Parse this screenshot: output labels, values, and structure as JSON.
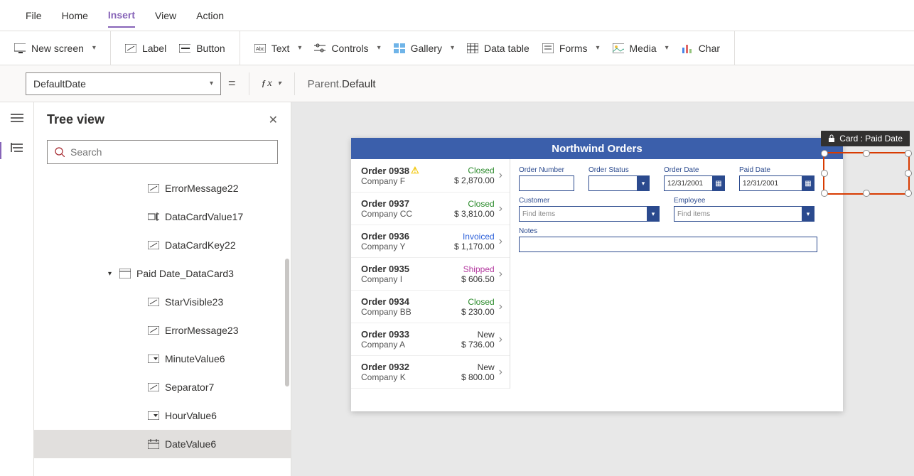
{
  "menu": {
    "items": [
      "File",
      "Home",
      "Insert",
      "View",
      "Action"
    ],
    "active": "Insert"
  },
  "ribbon": {
    "new_screen": "New screen",
    "label": "Label",
    "button": "Button",
    "text": "Text",
    "controls": "Controls",
    "gallery": "Gallery",
    "data_table": "Data table",
    "forms": "Forms",
    "media": "Media",
    "charts": "Char"
  },
  "formula": {
    "property": "DefaultDate",
    "prefix": "Parent.",
    "value": "Default"
  },
  "tree": {
    "title": "Tree view",
    "search_placeholder": "Search",
    "items": [
      {
        "name": "ErrorMessage22",
        "icon": "label"
      },
      {
        "name": "DataCardValue17",
        "icon": "input"
      },
      {
        "name": "DataCardKey22",
        "icon": "label"
      },
      {
        "name": "Paid Date_DataCard3",
        "icon": "card",
        "parent": true
      },
      {
        "name": "StarVisible23",
        "icon": "label"
      },
      {
        "name": "ErrorMessage23",
        "icon": "label"
      },
      {
        "name": "MinuteValue6",
        "icon": "dropdown"
      },
      {
        "name": "Separator7",
        "icon": "label"
      },
      {
        "name": "HourValue6",
        "icon": "dropdown"
      },
      {
        "name": "DateValue6",
        "icon": "date",
        "selected": true
      }
    ]
  },
  "selection_tooltip": "Card : Paid Date",
  "app": {
    "title": "Northwind Orders",
    "orders": [
      {
        "num": "Order 0938",
        "warn": true,
        "company": "Company F",
        "status": "Closed",
        "status_cls": "st-closed",
        "amount": "$ 2,870.00"
      },
      {
        "num": "Order 0937",
        "company": "Company CC",
        "status": "Closed",
        "status_cls": "st-closed",
        "amount": "$ 3,810.00"
      },
      {
        "num": "Order 0936",
        "company": "Company Y",
        "status": "Invoiced",
        "status_cls": "st-invoiced",
        "amount": "$ 1,170.00"
      },
      {
        "num": "Order 0935",
        "company": "Company I",
        "status": "Shipped",
        "status_cls": "st-shipped",
        "amount": "$ 606.50"
      },
      {
        "num": "Order 0934",
        "company": "Company BB",
        "status": "Closed",
        "status_cls": "st-closed",
        "amount": "$ 230.00"
      },
      {
        "num": "Order 0933",
        "company": "Company A",
        "status": "New",
        "status_cls": "st-new",
        "amount": "$ 736.00"
      },
      {
        "num": "Order 0932",
        "company": "Company K",
        "status": "New",
        "status_cls": "st-new",
        "amount": "$ 800.00"
      }
    ],
    "form": {
      "order_number": "Order Number",
      "order_status": "Order Status",
      "order_date": "Order Date",
      "order_date_val": "12/31/2001",
      "paid_date": "Paid Date",
      "paid_date_val": "12/31/2001",
      "customer": "Customer",
      "employee": "Employee",
      "find_items": "Find items",
      "notes": "Notes"
    }
  }
}
